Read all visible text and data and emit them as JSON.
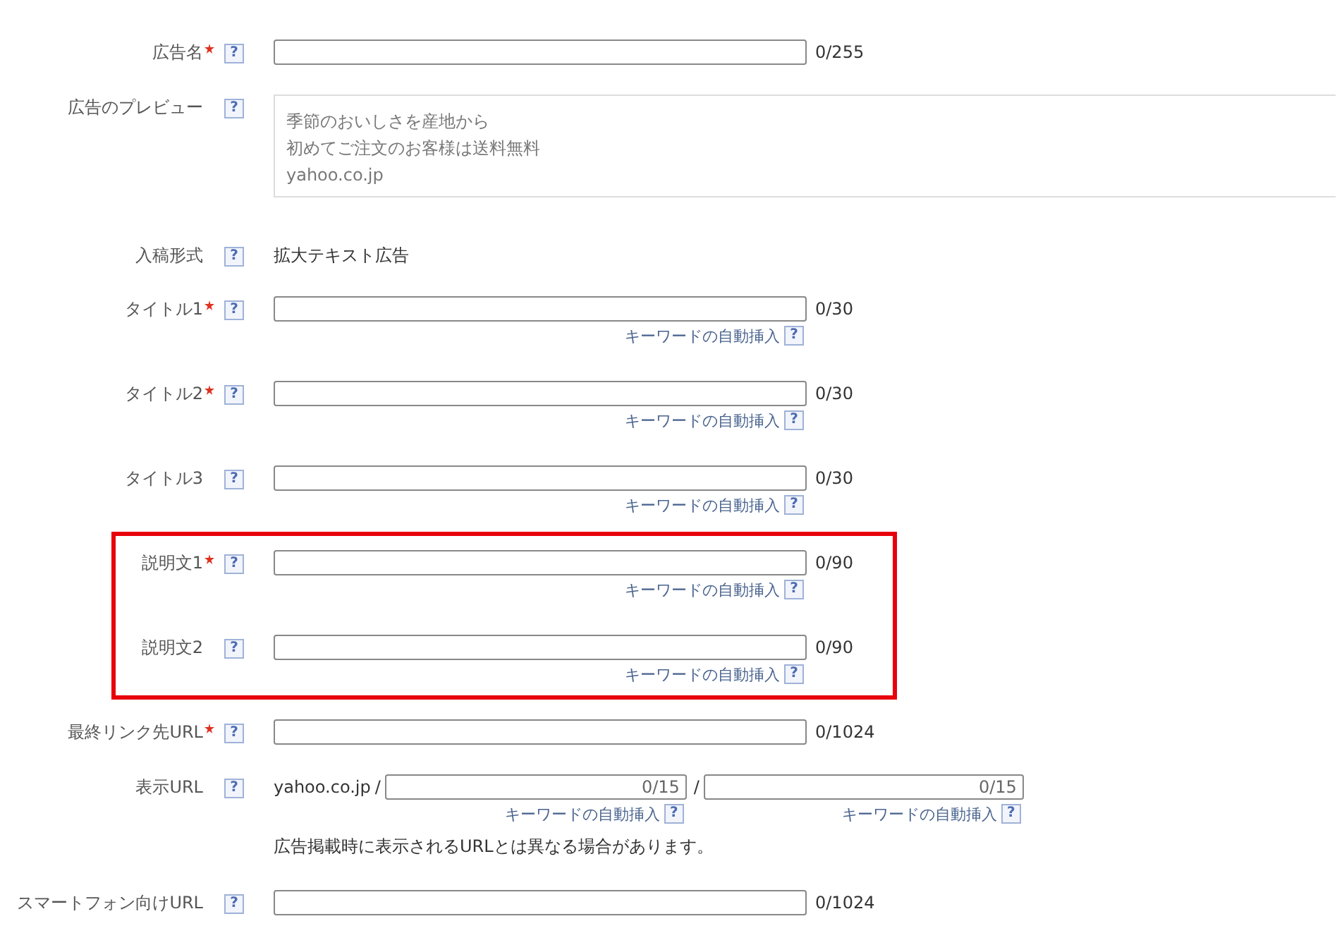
{
  "sections": [
    {
      "highlighted": false,
      "rows": [
        {
          "kind": "input",
          "label": "広告名",
          "required": true,
          "help": "?",
          "counter": "0/255"
        },
        {
          "kind": "preview",
          "label": "広告のプレビュー",
          "required": false,
          "help": "?",
          "lines": [
            "季節のおいしさを産地から",
            "初めてご注文のお客様は送料無料",
            "yahoo.co.jp"
          ]
        },
        {
          "kind": "text",
          "label": "入稿形式",
          "required": false,
          "help": "?",
          "value": "拡大テキスト広告"
        },
        {
          "kind": "input",
          "label": "タイトル1",
          "required": true,
          "help": "?",
          "counter": "0/30",
          "keyword_link": {
            "label": "キーワードの自動挿入",
            "help": "?"
          }
        },
        {
          "kind": "input",
          "label": "タイトル2",
          "required": true,
          "help": "?",
          "counter": "0/30",
          "keyword_link": {
            "label": "キーワードの自動挿入",
            "help": "?"
          }
        },
        {
          "kind": "input",
          "label": "タイトル3",
          "required": false,
          "help": "?",
          "counter": "0/30",
          "keyword_link": {
            "label": "キーワードの自動挿入",
            "help": "?"
          }
        }
      ]
    },
    {
      "highlighted": true,
      "rows": [
        {
          "kind": "input",
          "label": "説明文1",
          "required": true,
          "help": "?",
          "counter": "0/90",
          "keyword_link": {
            "label": "キーワードの自動挿入",
            "help": "?"
          }
        },
        {
          "kind": "input",
          "label": "説明文2",
          "required": false,
          "help": "?",
          "counter": "0/90",
          "keyword_link": {
            "label": "キーワードの自動挿入",
            "help": "?"
          }
        }
      ]
    },
    {
      "highlighted": false,
      "rows": [
        {
          "kind": "input",
          "label": "最終リンク先URL",
          "required": true,
          "help": "?",
          "counter": "0/1024"
        },
        {
          "kind": "display_url",
          "label": "表示URL",
          "required": false,
          "help": "?",
          "domain": "yahoo.co.jp",
          "paths": [
            {
              "separator": "/",
              "counter": "0/15",
              "keyword_link": {
                "label": "キーワードの自動挿入",
                "help": "?"
              }
            },
            {
              "separator": "/",
              "counter": "0/15",
              "keyword_link": {
                "label": "キーワードの自動挿入",
                "help": "?"
              }
            }
          ],
          "note": "広告掲載時に表示されるURLとは異なる場合があります。"
        },
        {
          "kind": "input",
          "label": "スマートフォン向けURL",
          "required": false,
          "help": "?",
          "counter": "0/1024"
        }
      ]
    }
  ]
}
